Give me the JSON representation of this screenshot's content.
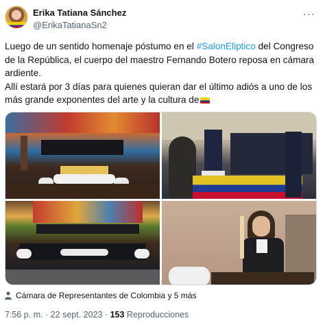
{
  "author": {
    "name": "Erika Tatiana Sánchez",
    "handle": "@ErikaTatianaSn2"
  },
  "menu_icon": "more-icon",
  "tweet": {
    "p1_before": "Luego de un sentido homenaje póstumo en el ",
    "hashtag": "#SalonEliptico",
    "p1_after": " del Congreso de la República, el cuerpo del maestro Fernando Botero reposa en cámara ardiente.",
    "p2": "Allí estará por 3 días para quienes quieran dar el último adiós a uno de los más grande exponentes del arte y la cultura de",
    "flag_icon": "colombia-flag-icon"
  },
  "media": {
    "photos": [
      {
        "name": "photo-coffin-ceremony"
      },
      {
        "name": "photo-honor-guard"
      },
      {
        "name": "photo-elliptical-hall"
      },
      {
        "name": "photo-speaker-podium"
      }
    ]
  },
  "location": {
    "icon": "person-tag-icon",
    "text": "Cámara de Representantes de Colombia y 5 más"
  },
  "meta": {
    "time_date": "7:56 p. m. · 22 sept. 2023 · ",
    "views_count": "153",
    "views_label": " Reproducciones"
  },
  "colors": {
    "link": "#1d9bf0",
    "secondary_text": "#536471"
  }
}
